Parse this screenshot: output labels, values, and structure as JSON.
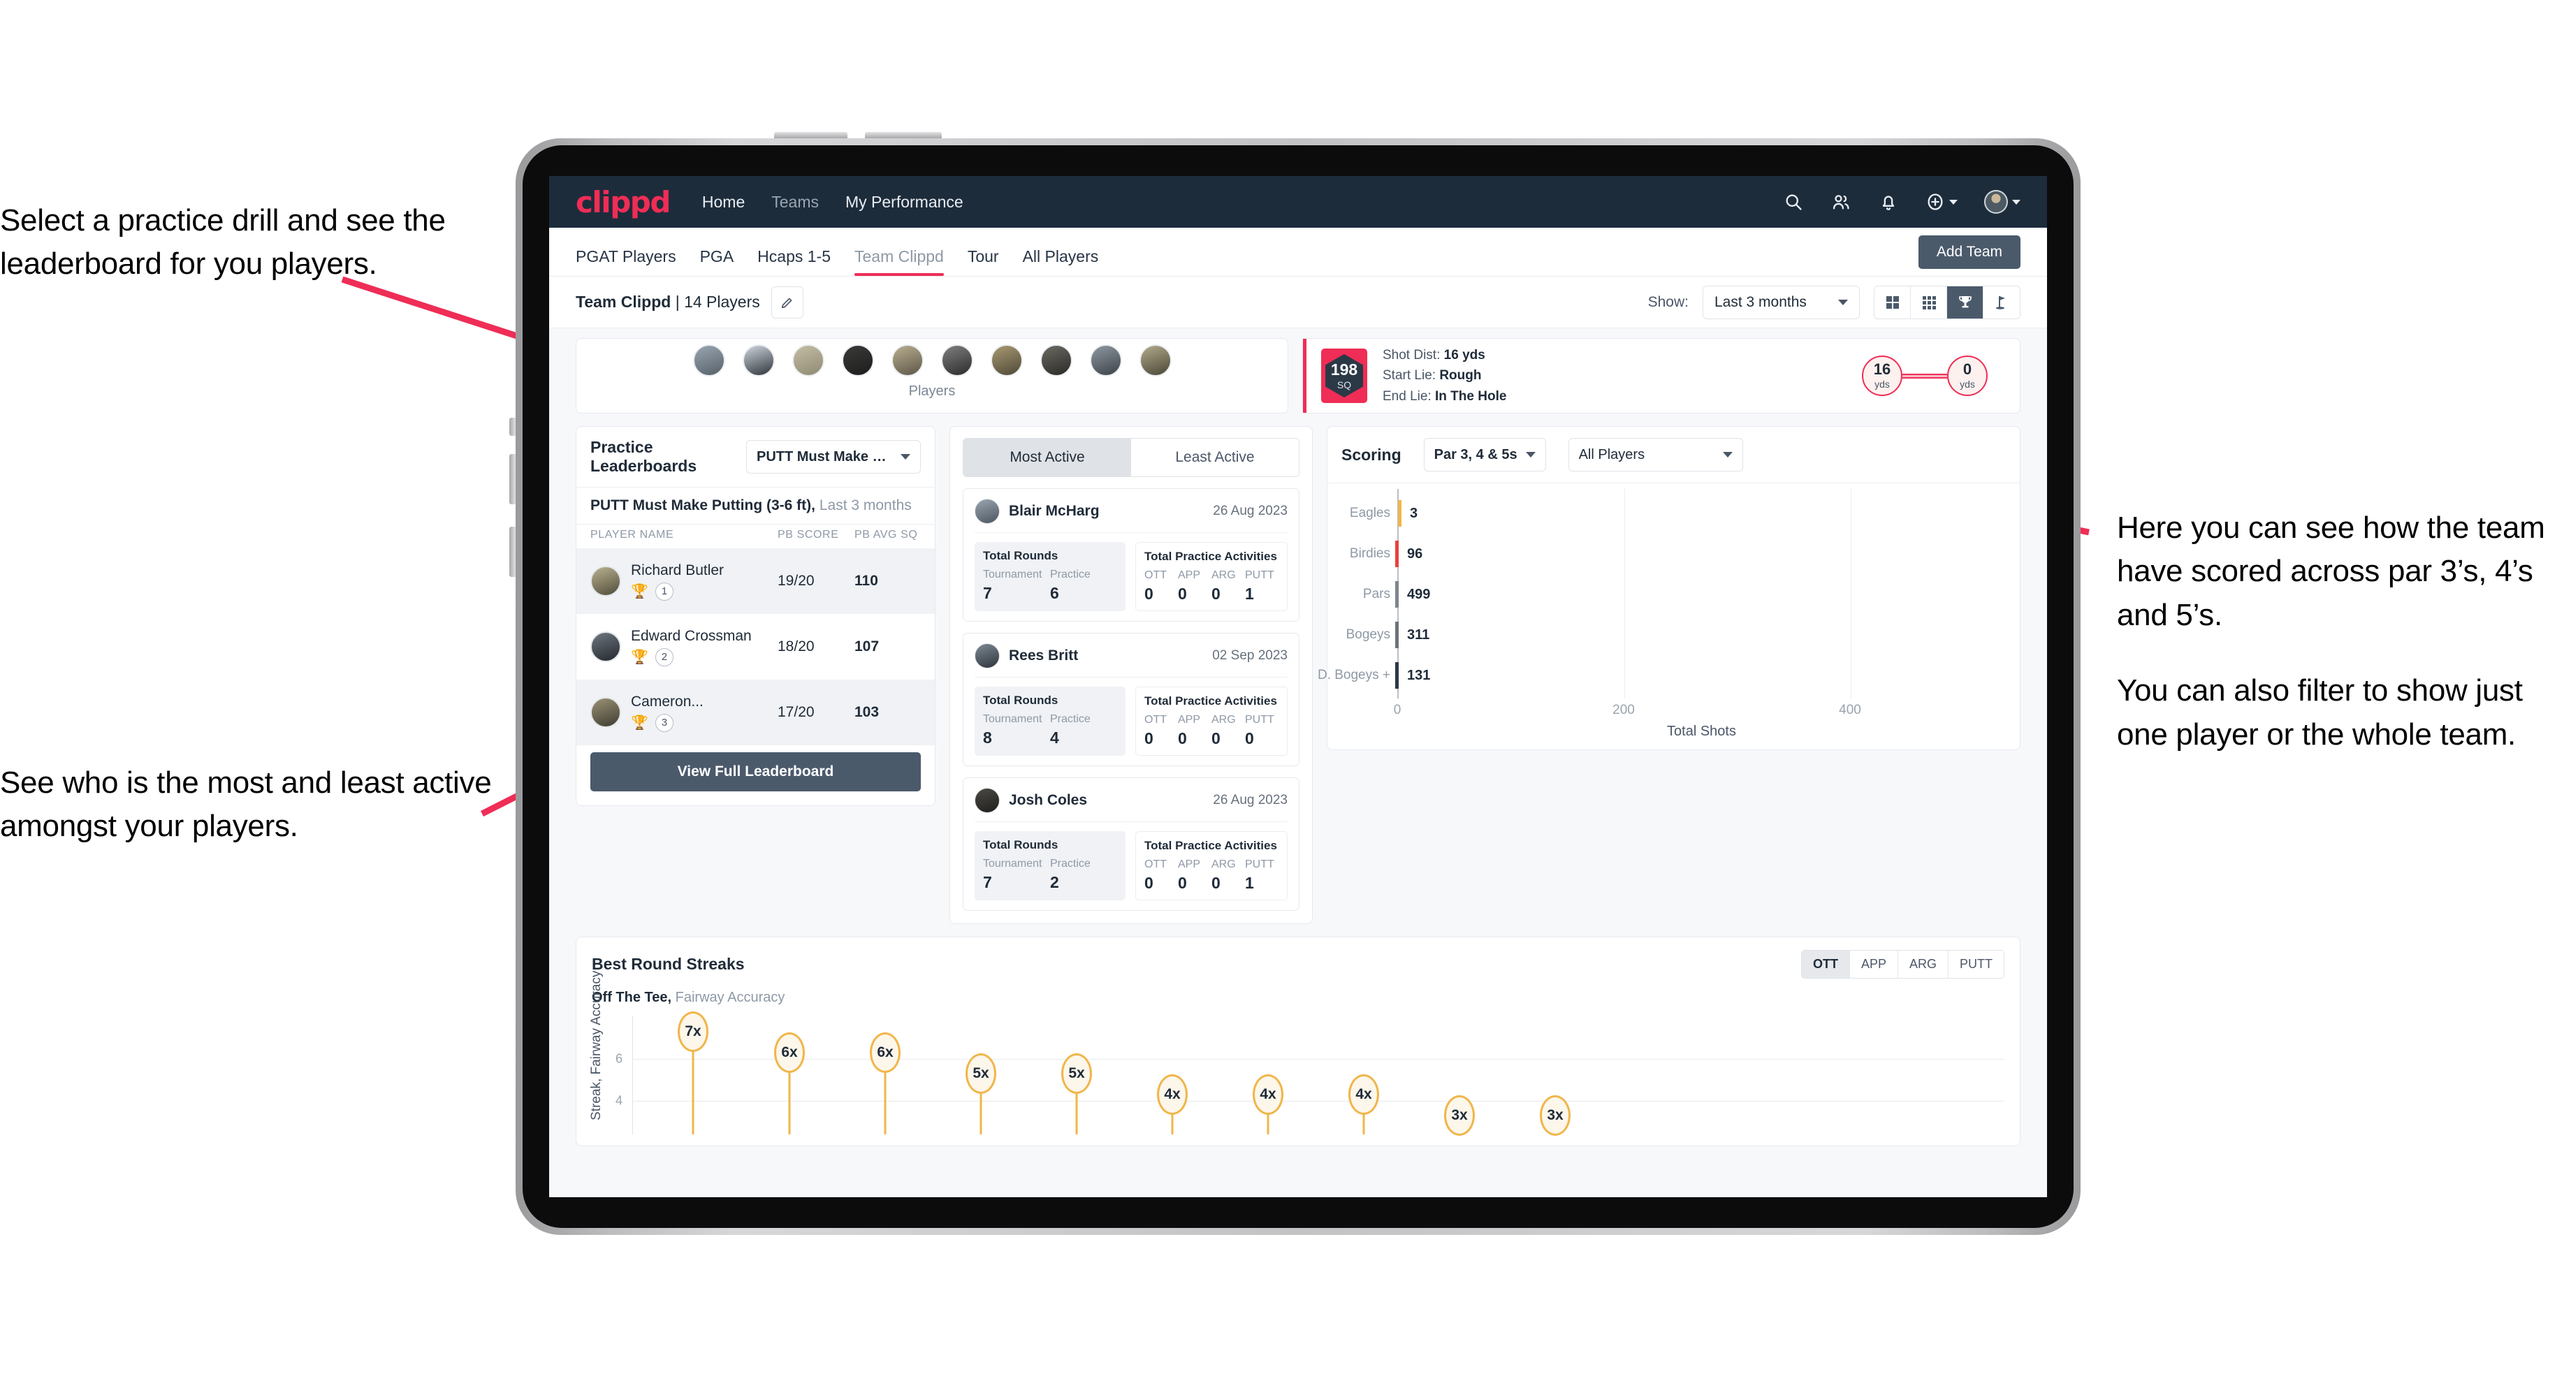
{
  "annotations": {
    "left_top": "Select a practice drill and see the leaderboard for you players.",
    "left_bottom": "See who is the most and least active amongst your players.",
    "right_p1": "Here you can see how the team have scored across par 3’s, 4’s and 5’s.",
    "right_p2": "You can also filter to show just one player or the whole team."
  },
  "navbar": {
    "logo": "clippd",
    "links": [
      {
        "label": "Home",
        "muted": false
      },
      {
        "label": "Teams",
        "muted": true
      },
      {
        "label": "My Performance",
        "muted": false
      }
    ],
    "icons": [
      "search-icon",
      "people-icon",
      "bell-icon",
      "plus-circle-icon",
      "avatar"
    ]
  },
  "tabs": {
    "items": [
      {
        "label": "PGAT Players",
        "active": false,
        "muted": false
      },
      {
        "label": "PGA",
        "active": false,
        "muted": false
      },
      {
        "label": "Hcaps 1-5",
        "active": false,
        "muted": false
      },
      {
        "label": "Team Clippd",
        "active": true,
        "muted": true
      },
      {
        "label": "Tour",
        "active": false,
        "muted": false
      },
      {
        "label": "All Players",
        "active": false,
        "muted": false
      }
    ],
    "add_team_label": "Add Team"
  },
  "subheader": {
    "team_name": "Team Clippd",
    "team_count": "| 14 Players",
    "edit_icon": "pencil-icon",
    "show_label": "Show:",
    "range_value": "Last 3 months",
    "view_toggles": [
      {
        "icon": "grid-2x2-icon",
        "active": false
      },
      {
        "icon": "grid-3x3-icon",
        "active": false
      },
      {
        "icon": "trophy-icon",
        "active": true
      },
      {
        "icon": "golf-flag-icon",
        "active": false
      }
    ]
  },
  "players_strip": {
    "caption": "Players",
    "count": 10
  },
  "shot_card": {
    "badge_value": "198",
    "badge_unit": "SQ",
    "lines": [
      {
        "label": "Shot Dist:",
        "value": "16 yds"
      },
      {
        "label": "Start Lie:",
        "value": "Rough"
      },
      {
        "label": "End Lie:",
        "value": "In The Hole"
      }
    ],
    "start_dist": "16",
    "start_unit": "yds",
    "end_dist": "0",
    "end_unit": "yds"
  },
  "leaderboard": {
    "title": "Practice Leaderboards",
    "drill_select": "PUTT Must Make Putting ...",
    "drill_name": "PUTT Must Make Putting (3-6 ft),",
    "drill_range": "Last 3 months",
    "columns": [
      "PLAYER NAME",
      "PB SCORE",
      "PB AVG SQ"
    ],
    "rows": [
      {
        "name": "Richard Butler",
        "rank": "1",
        "trophy": "gold",
        "score": "19/20",
        "avg": "110"
      },
      {
        "name": "Edward Crossman",
        "rank": "2",
        "trophy": "silver",
        "score": "18/20",
        "avg": "107"
      },
      {
        "name": "Cameron...",
        "rank": "3",
        "trophy": "bronze",
        "score": "17/20",
        "avg": "103"
      }
    ],
    "button_label": "View Full Leaderboard"
  },
  "activity": {
    "tabs": [
      {
        "label": "Most Active",
        "active": true
      },
      {
        "label": "Least Active",
        "active": false
      }
    ],
    "rounds_title": "Total Rounds",
    "rounds_cols": [
      "Tournament",
      "Practice"
    ],
    "practice_title": "Total Practice Activities",
    "practice_cols": [
      "OTT",
      "APP",
      "ARG",
      "PUTT"
    ],
    "players": [
      {
        "name": "Blair McHarg",
        "date": "26 Aug 2023",
        "tournament": "7",
        "practice": "6",
        "ott": "0",
        "app": "0",
        "arg": "0",
        "putt": "1"
      },
      {
        "name": "Rees Britt",
        "date": "02 Sep 2023",
        "tournament": "8",
        "practice": "4",
        "ott": "0",
        "app": "0",
        "arg": "0",
        "putt": "0"
      },
      {
        "name": "Josh Coles",
        "date": "26 Aug 2023",
        "tournament": "7",
        "practice": "2",
        "ott": "0",
        "app": "0",
        "arg": "0",
        "putt": "1"
      }
    ]
  },
  "scoring": {
    "title": "Scoring",
    "par_filter": "Par 3, 4 & 5s",
    "player_filter": "All Players"
  },
  "streaks": {
    "title": "Best Round Streaks",
    "tabs": [
      {
        "label": "OTT",
        "active": true
      },
      {
        "label": "APP",
        "active": false
      },
      {
        "label": "ARG",
        "active": false
      },
      {
        "label": "PUTT",
        "active": false
      }
    ],
    "subtitle_bold": "Off The Tee,",
    "subtitle_rest": " Fairway Accuracy"
  },
  "chart_data": [
    {
      "type": "bar",
      "orientation": "horizontal",
      "title": "Scoring",
      "categories": [
        "Eagles",
        "Birdies",
        "Pars",
        "Bogeys",
        "D. Bogeys +"
      ],
      "values": [
        3,
        96,
        499,
        311,
        131
      ],
      "cap_colors": [
        "#f0b64a",
        "#e8413f",
        "#7d858e",
        "#6b737c",
        "#2b3846"
      ],
      "xlabel": "Total Shots",
      "ylabel": "",
      "xlim": [
        0,
        520
      ],
      "xticks": [
        0,
        200,
        400
      ],
      "grid": true,
      "legend": "none"
    },
    {
      "type": "bar",
      "title": "Best Round Streaks",
      "subtitle": "Off The Tee, Fairway Accuracy",
      "ylabel": "Streak, Fairway Accuracy",
      "categories": [
        "1",
        "2",
        "3",
        "4",
        "5",
        "6",
        "7",
        "8",
        "9",
        "10"
      ],
      "values": [
        7,
        6,
        6,
        5,
        5,
        4,
        4,
        4,
        3,
        3
      ],
      "labels": [
        "7x",
        "6x",
        "6x",
        "5x",
        "5x",
        "4x",
        "4x",
        "4x",
        "3x",
        "3x"
      ],
      "yticks": [
        4,
        6
      ],
      "ylim": [
        0,
        8
      ],
      "grid": true,
      "legend": "none"
    }
  ]
}
